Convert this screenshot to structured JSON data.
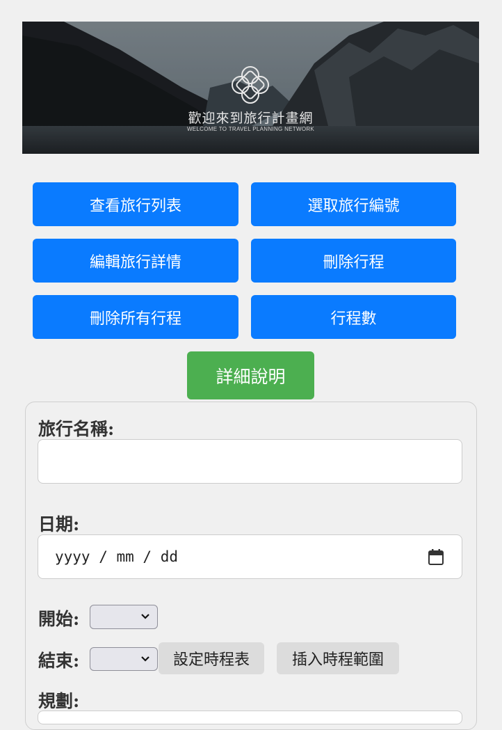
{
  "banner": {
    "title": "歡迎來到旅行計畫網",
    "subtitle": "WELCOME TO TRAVEL PLANNING NETWORK"
  },
  "buttons": {
    "view_list": "查看旅行列表",
    "select_id": "選取旅行編號",
    "edit_details": "編輯旅行詳情",
    "delete_trip": "刪除行程",
    "delete_all": "刪除所有行程",
    "trip_count": "行程數",
    "details": "詳細說明"
  },
  "form": {
    "name_label": "旅行名稱:",
    "name_value": "",
    "date_label": "日期:",
    "date_placeholder": "yyyy / mm / dd",
    "start_label": "開始:",
    "end_label": "結束:",
    "set_schedule": "設定時程表",
    "insert_range": "插入時程範圍",
    "plan_label": "規劃:"
  },
  "colors": {
    "primary_button": "#0a7bff",
    "detail_button": "#4caf50",
    "secondary_button": "#dcdcdc",
    "page_background": "#f0f0f0"
  }
}
